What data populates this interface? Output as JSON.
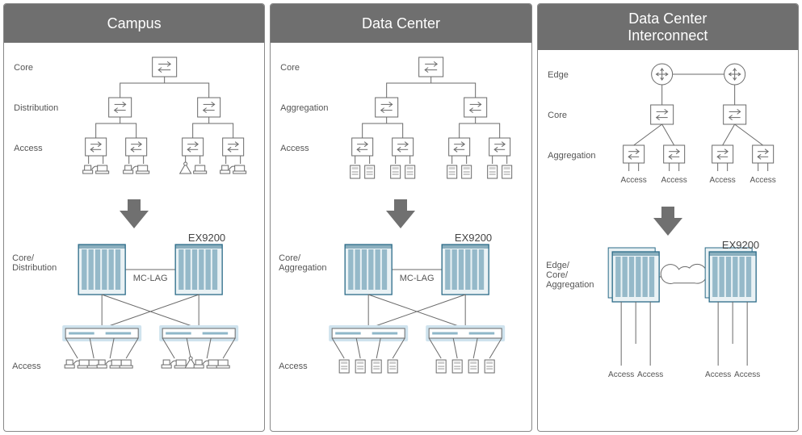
{
  "panels": [
    {
      "title": "Campus",
      "tree": {
        "tiers": [
          "Core",
          "Distribution",
          "Access"
        ],
        "leaf_type": "endpoint"
      },
      "collapsed": {
        "left_label": "Core/\nDistribution",
        "link_label": "MC-LAG",
        "right_label": "EX9200",
        "access_label": "Access",
        "leaf_type": "endpoint",
        "center_agg": true,
        "agg_hilite": true
      }
    },
    {
      "title": "Data Center",
      "tree": {
        "tiers": [
          "Core",
          "Aggregation",
          "Access"
        ],
        "leaf_type": "server"
      },
      "collapsed": {
        "left_label": "Core/\nAggregation",
        "link_label": "MC-LAG",
        "right_label": "EX9200",
        "access_label": "Access",
        "leaf_type": "server",
        "center_agg": true,
        "agg_hilite": true
      }
    },
    {
      "title": "Data Center\nInterconnect",
      "tree": {
        "tiers": [
          "Edge",
          "Core",
          "Aggregation"
        ],
        "leaf_type": "access_text",
        "top_is_pair": true
      },
      "collapsed": {
        "left_label": "Edge/\nCore/\nAggregation",
        "link_label": "",
        "right_label": "EX9200",
        "access_label": "",
        "leaf_type": "access_text",
        "cloud_center": true,
        "stacked_chassis": true
      }
    }
  ]
}
